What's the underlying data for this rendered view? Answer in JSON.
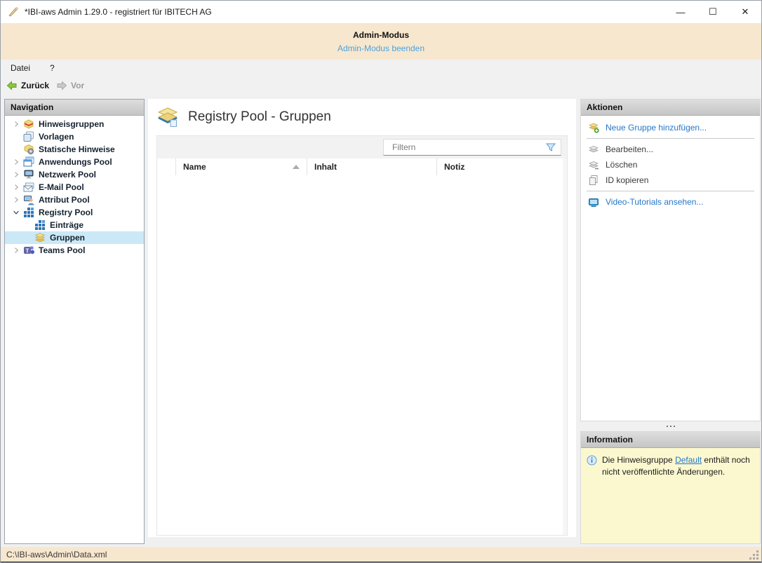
{
  "window": {
    "title": "*IBI-aws Admin 1.29.0 - registriert für IBITECH AG",
    "controls": {
      "minimize": "—",
      "maximize": "☐",
      "close": "✕"
    }
  },
  "banner": {
    "title": "Admin-Modus",
    "link": "Admin-Modus beenden"
  },
  "menubar": {
    "items": [
      {
        "label": "Datei"
      },
      {
        "label": "?"
      }
    ]
  },
  "toolbar": {
    "back_label": "Zurück",
    "forward_label": "Vor"
  },
  "navigation": {
    "header": "Navigation",
    "items": [
      {
        "label": "Hinweisgruppen",
        "icon": "notice-groups-icon",
        "expander": "collapsed",
        "level": 0,
        "selected": false
      },
      {
        "label": "Vorlagen",
        "icon": "templates-icon",
        "expander": "none",
        "level": 0,
        "selected": false
      },
      {
        "label": "Statische Hinweise",
        "icon": "static-notices-icon",
        "expander": "none",
        "level": 0,
        "selected": false
      },
      {
        "label": "Anwendungs Pool",
        "icon": "applications-pool-icon",
        "expander": "collapsed",
        "level": 0,
        "selected": false
      },
      {
        "label": "Netzwerk Pool",
        "icon": "network-pool-icon",
        "expander": "collapsed",
        "level": 0,
        "selected": false
      },
      {
        "label": "E-Mail Pool",
        "icon": "email-pool-icon",
        "expander": "collapsed",
        "level": 0,
        "selected": false
      },
      {
        "label": "Attribut Pool",
        "icon": "attribute-pool-icon",
        "expander": "collapsed",
        "level": 0,
        "selected": false
      },
      {
        "label": "Registry Pool",
        "icon": "registry-pool-icon",
        "expander": "expanded",
        "level": 0,
        "selected": false
      },
      {
        "label": "Einträge",
        "icon": "entries-icon",
        "expander": "none",
        "level": 1,
        "selected": false
      },
      {
        "label": "Gruppen",
        "icon": "groups-icon",
        "expander": "none",
        "level": 1,
        "selected": true
      },
      {
        "label": "Teams Pool",
        "icon": "teams-pool-icon",
        "expander": "collapsed",
        "level": 0,
        "selected": false
      }
    ]
  },
  "main": {
    "title": "Registry Pool - Gruppen",
    "filter_placeholder": "Filtern",
    "table": {
      "columns": [
        "Name",
        "Inhalt",
        "Notiz"
      ],
      "sort_column": "Name",
      "sort_direction": "ascending",
      "rows": []
    }
  },
  "actions": {
    "header": "Aktionen",
    "items": [
      {
        "label": "Neue Gruppe hinzufügen...",
        "icon": "add-group-icon",
        "style": "link"
      },
      {
        "label": "Bearbeiten...",
        "icon": "edit-group-icon",
        "style": "disabled"
      },
      {
        "label": "Löschen",
        "icon": "delete-group-icon",
        "style": "disabled"
      },
      {
        "label": "ID kopieren",
        "icon": "copy-id-icon",
        "style": "disabled"
      },
      {
        "label": "Video-Tutorials ansehen...",
        "icon": "video-tutorials-icon",
        "style": "link"
      }
    ]
  },
  "information": {
    "header": "Information",
    "message_before": "Die Hinweisgruppe ",
    "message_link": "Default",
    "message_after": " enthält noch nicht veröffentlichte Änderungen."
  },
  "statusbar": {
    "path": "C:\\IBI-aws\\Admin\\Data.xml"
  },
  "colors": {
    "banner_background": "#F7E7CE",
    "selection_background": "#CBE8F6",
    "link_blue": "#2577C9",
    "banner_link_blue": "#4AA3E0",
    "info_background": "#FBF8CF",
    "panel_header_gray": "#CFCFCF"
  }
}
